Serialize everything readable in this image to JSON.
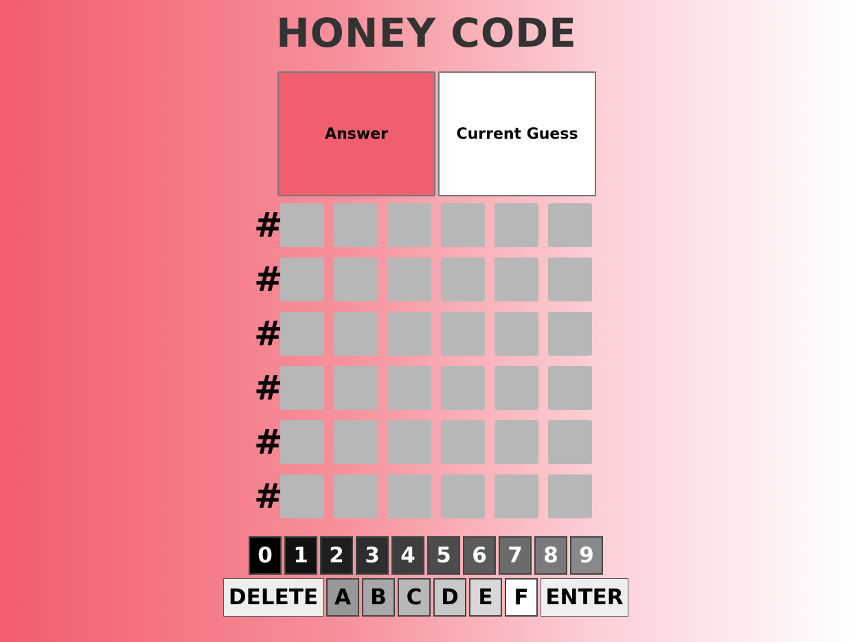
{
  "title": "HONEY CODE",
  "panels": {
    "answer": "Answer",
    "current_guess": "Current Guess"
  },
  "row_marker": "#",
  "rows": 6,
  "cols": 6,
  "digit_keys": [
    {
      "label": "0",
      "bg": "#000000",
      "fg": "#ffffff"
    },
    {
      "label": "1",
      "bg": "#111111",
      "fg": "#ffffff"
    },
    {
      "label": "2",
      "bg": "#1f1f1f",
      "fg": "#ffffff"
    },
    {
      "label": "3",
      "bg": "#2e2e2e",
      "fg": "#ffffff"
    },
    {
      "label": "4",
      "bg": "#3d3d3d",
      "fg": "#ffffff"
    },
    {
      "label": "5",
      "bg": "#4c4c4c",
      "fg": "#ffffff"
    },
    {
      "label": "6",
      "bg": "#5b5b5b",
      "fg": "#ffffff"
    },
    {
      "label": "7",
      "bg": "#6b6b6b",
      "fg": "#ffffff"
    },
    {
      "label": "8",
      "bg": "#7a7a7a",
      "fg": "#ffffff"
    },
    {
      "label": "9",
      "bg": "#898989",
      "fg": "#ffffff"
    }
  ],
  "letter_keys": [
    {
      "label": "DELETE",
      "bg": "#eeeeee",
      "fg": "#000000"
    },
    {
      "label": "A",
      "bg": "#989898",
      "fg": "#000000"
    },
    {
      "label": "B",
      "bg": "#a8a8a8",
      "fg": "#000000"
    },
    {
      "label": "C",
      "bg": "#b8b8b8",
      "fg": "#000000"
    },
    {
      "label": "D",
      "bg": "#c8c8c8",
      "fg": "#000000"
    },
    {
      "label": "E",
      "bg": "#d8d8d8",
      "fg": "#000000"
    },
    {
      "label": "F",
      "bg": "#ffffff",
      "fg": "#000000"
    },
    {
      "label": "ENTER",
      "bg": "#eeeeee",
      "fg": "#000000"
    }
  ]
}
